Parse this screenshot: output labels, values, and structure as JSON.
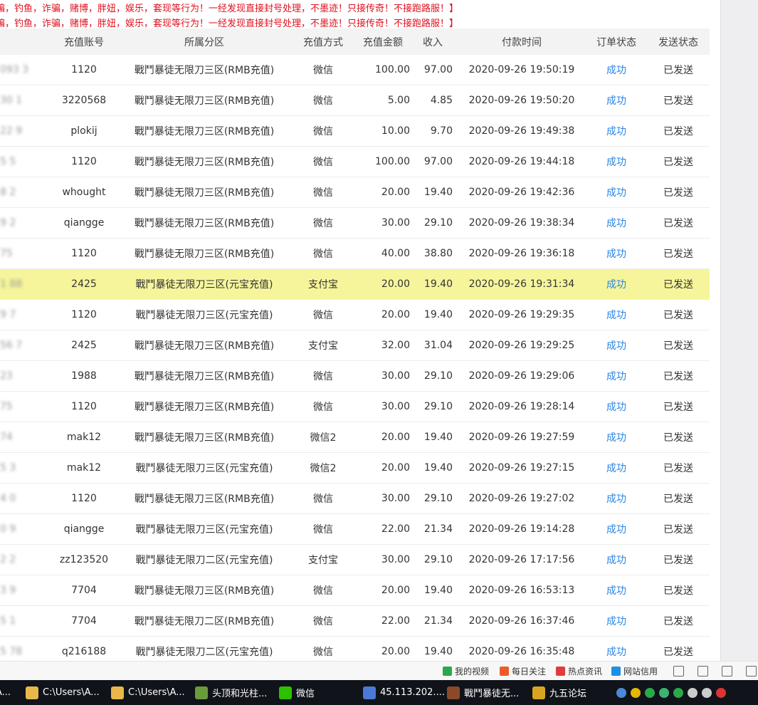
{
  "notice": {
    "line1": "骗，钓鱼，诈骗，赌博，胖妞，娱乐，套现等行为！一经发现直接封号处理，不墨迹！只接传奇！不接跑路服！】",
    "line2": "骗，钓鱼，诈骗，赌博，胖妞，娱乐，套现等行为！一经发现直接封号处理，不墨迹！只接传奇！不接跑路服！】"
  },
  "table": {
    "headers": {
      "account": "充值账号",
      "zone": "所属分区",
      "method": "充值方式",
      "amount": "充值金额",
      "income": "收入",
      "time": "付款时间",
      "status": "订单状态",
      "send": "发送状态"
    },
    "rows": [
      {
        "id": "093 3",
        "account": "1120",
        "zone": "戰鬥暴徒无限刀三区(RMB充值)",
        "method": "微信",
        "amount": "100.00",
        "income": "97.00",
        "time": "2020-09-26 19:50:19",
        "status": "成功",
        "send": "已发送"
      },
      {
        "id": "30 1",
        "account": "3220568",
        "zone": "戰鬥暴徒无限刀三区(RMB充值)",
        "method": "微信",
        "amount": "5.00",
        "income": "4.85",
        "time": "2020-09-26 19:50:20",
        "status": "成功",
        "send": "已发送"
      },
      {
        "id": "22 9",
        "account": "plokij",
        "zone": "戰鬥暴徒无限刀三区(RMB充值)",
        "method": "微信",
        "amount": "10.00",
        "income": "9.70",
        "time": "2020-09-26 19:49:38",
        "status": "成功",
        "send": "已发送"
      },
      {
        "id": "5 5",
        "account": "1120",
        "zone": "戰鬥暴徒无限刀三区(RMB充值)",
        "method": "微信",
        "amount": "100.00",
        "income": "97.00",
        "time": "2020-09-26 19:44:18",
        "status": "成功",
        "send": "已发送"
      },
      {
        "id": "8 2",
        "account": "whought",
        "zone": "戰鬥暴徒无限刀三区(RMB充值)",
        "method": "微信",
        "amount": "20.00",
        "income": "19.40",
        "time": "2020-09-26 19:42:36",
        "status": "成功",
        "send": "已发送"
      },
      {
        "id": "9 2",
        "account": "qiangge",
        "zone": "戰鬥暴徒无限刀三区(RMB充值)",
        "method": "微信",
        "amount": "30.00",
        "income": "29.10",
        "time": "2020-09-26 19:38:34",
        "status": "成功",
        "send": "已发送"
      },
      {
        "id": "75",
        "account": "1120",
        "zone": "戰鬥暴徒无限刀三区(RMB充值)",
        "method": "微信",
        "amount": "40.00",
        "income": "38.80",
        "time": "2020-09-26 19:36:18",
        "status": "成功",
        "send": "已发送"
      },
      {
        "id": "1 88",
        "account": "2425",
        "zone": "戰鬥暴徒无限刀三区(元宝充值)",
        "method": "支付宝",
        "amount": "20.00",
        "income": "19.40",
        "time": "2020-09-26 19:31:34",
        "status": "成功",
        "send": "已发送",
        "highlight": "yes"
      },
      {
        "id": "9 7",
        "account": "1120",
        "zone": "戰鬥暴徒无限刀三区(元宝充值)",
        "method": "微信",
        "amount": "20.00",
        "income": "19.40",
        "time": "2020-09-26 19:29:35",
        "status": "成功",
        "send": "已发送"
      },
      {
        "id": "56 7",
        "account": "2425",
        "zone": "戰鬥暴徒无限刀三区(RMB充值)",
        "method": "支付宝",
        "amount": "32.00",
        "income": "31.04",
        "time": "2020-09-26 19:29:25",
        "status": "成功",
        "send": "已发送"
      },
      {
        "id": "23",
        "account": "1988",
        "zone": "戰鬥暴徒无限刀三区(RMB充值)",
        "method": "微信",
        "amount": "30.00",
        "income": "29.10",
        "time": "2020-09-26 19:29:06",
        "status": "成功",
        "send": "已发送"
      },
      {
        "id": "75",
        "account": "1120",
        "zone": "戰鬥暴徒无限刀三区(RMB充值)",
        "method": "微信",
        "amount": "30.00",
        "income": "29.10",
        "time": "2020-09-26 19:28:14",
        "status": "成功",
        "send": "已发送"
      },
      {
        "id": "74",
        "account": "mak12",
        "zone": "戰鬥暴徒无限刀三区(RMB充值)",
        "method": "微信2",
        "amount": "20.00",
        "income": "19.40",
        "time": "2020-09-26 19:27:59",
        "status": "成功",
        "send": "已发送"
      },
      {
        "id": "5 3",
        "account": "mak12",
        "zone": "戰鬥暴徒无限刀三区(元宝充值)",
        "method": "微信2",
        "amount": "20.00",
        "income": "19.40",
        "time": "2020-09-26 19:27:15",
        "status": "成功",
        "send": "已发送"
      },
      {
        "id": "4 0",
        "account": "1120",
        "zone": "戰鬥暴徒无限刀三区(RMB充值)",
        "method": "微信",
        "amount": "30.00",
        "income": "29.10",
        "time": "2020-09-26 19:27:02",
        "status": "成功",
        "send": "已发送"
      },
      {
        "id": "0 9",
        "account": "qiangge",
        "zone": "戰鬥暴徒无限刀三区(元宝充值)",
        "method": "微信",
        "amount": "22.00",
        "income": "21.34",
        "time": "2020-09-26 19:14:28",
        "status": "成功",
        "send": "已发送"
      },
      {
        "id": "2 2",
        "account": "zz123520",
        "zone": "戰鬥暴徒无限刀二区(元宝充值)",
        "method": "支付宝",
        "amount": "30.00",
        "income": "29.10",
        "time": "2020-09-26 17:17:56",
        "status": "成功",
        "send": "已发送"
      },
      {
        "id": "3 9",
        "account": "7704",
        "zone": "戰鬥暴徒无限刀三区(RMB充值)",
        "method": "微信",
        "amount": "20.00",
        "income": "19.40",
        "time": "2020-09-26 16:53:13",
        "status": "成功",
        "send": "已发送"
      },
      {
        "id": "5 1",
        "account": "7704",
        "zone": "戰鬥暴徒无限刀二区(RMB充值)",
        "method": "微信",
        "amount": "22.00",
        "income": "21.34",
        "time": "2020-09-26 16:37:46",
        "status": "成功",
        "send": "已发送"
      },
      {
        "id": "5 78",
        "account": "q216188",
        "zone": "戰鬥暴徒无限刀二区(元宝充值)",
        "method": "微信",
        "amount": "20.00",
        "income": "19.40",
        "time": "2020-09-26 16:35:48",
        "status": "成功",
        "send": "已发送"
      }
    ]
  },
  "statusbar": {
    "items": [
      {
        "label": "我的视频",
        "icon": "video-icon",
        "color": "#2aa84a"
      },
      {
        "label": "每日关注",
        "icon": "flame-icon",
        "color": "#f05a28"
      },
      {
        "label": "热点资讯",
        "icon": "news-icon",
        "color": "#e03c3c"
      },
      {
        "label": "网站信用",
        "icon": "drop-icon",
        "color": "#1f8fe5"
      }
    ]
  },
  "taskbar": {
    "items": [
      {
        "label": "A...",
        "icon": "app-icon",
        "color": "#3a7bd5"
      },
      {
        "label": "C:\\Users\\A...",
        "icon": "folder-icon",
        "color": "#e8b84a"
      },
      {
        "label": "C:\\Users\\A...",
        "icon": "folder-icon",
        "color": "#e8b84a"
      },
      {
        "label": "头顶和光柱...",
        "icon": "archive-icon",
        "color": "#6a9a3a"
      },
      {
        "label": "微信",
        "icon": "wechat-icon",
        "color": "#2dc100"
      },
      {
        "label": "45.113.202....",
        "icon": "remote-desktop-icon",
        "color": "#4a7ad8"
      },
      {
        "label": "戰鬥暴徒无...",
        "icon": "game-icon",
        "color": "#8a4a2a"
      },
      {
        "label": "九五论坛",
        "icon": "forum-icon",
        "color": "#d9a520"
      }
    ]
  }
}
